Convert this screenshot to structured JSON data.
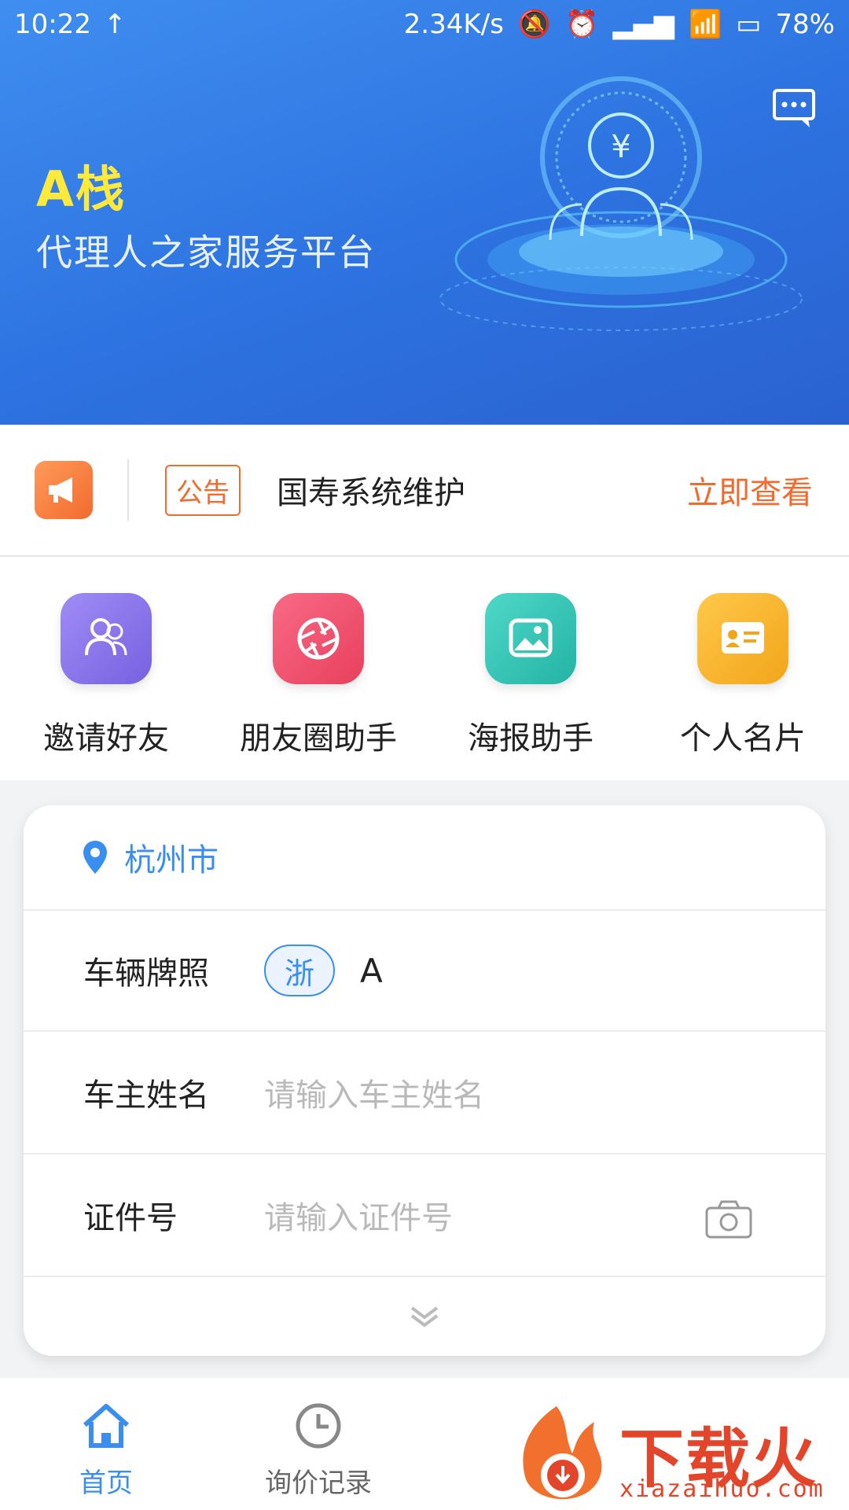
{
  "status_bar": {
    "time": "10:22",
    "network_speed": "2.34K/s",
    "battery": "78%"
  },
  "banner": {
    "title": "A栈",
    "subtitle": "代理人之家服务平台"
  },
  "notice": {
    "tag": "公告",
    "text": "国寿系统维护",
    "action": "立即查看"
  },
  "quick_actions": [
    {
      "label": "邀请好友",
      "icon": "invite-friends-icon",
      "color": "#8a73e8"
    },
    {
      "label": "朋友圈助手",
      "icon": "shutter-icon",
      "color": "#f0506e"
    },
    {
      "label": "海报助手",
      "icon": "image-icon",
      "color": "#35c4b5"
    },
    {
      "label": "个人名片",
      "icon": "business-card-icon",
      "color": "#f7b52b"
    }
  ],
  "form": {
    "city": "杭州市",
    "plate_label": "车辆牌照",
    "plate_province": "浙",
    "plate_value": "A",
    "owner_label": "车主姓名",
    "owner_placeholder": "请输入车主姓名",
    "id_label": "证件号",
    "id_placeholder": "请输入证件号"
  },
  "tabbar": [
    {
      "label": "首页",
      "active": true
    },
    {
      "label": "询价记录",
      "active": false
    }
  ],
  "watermark": {
    "text": "下载火",
    "url": "xiazaihuo.com"
  },
  "colors": {
    "primary": "#3a8ef0",
    "accent": "#f26b2e",
    "banner_title": "#ffe93b"
  }
}
